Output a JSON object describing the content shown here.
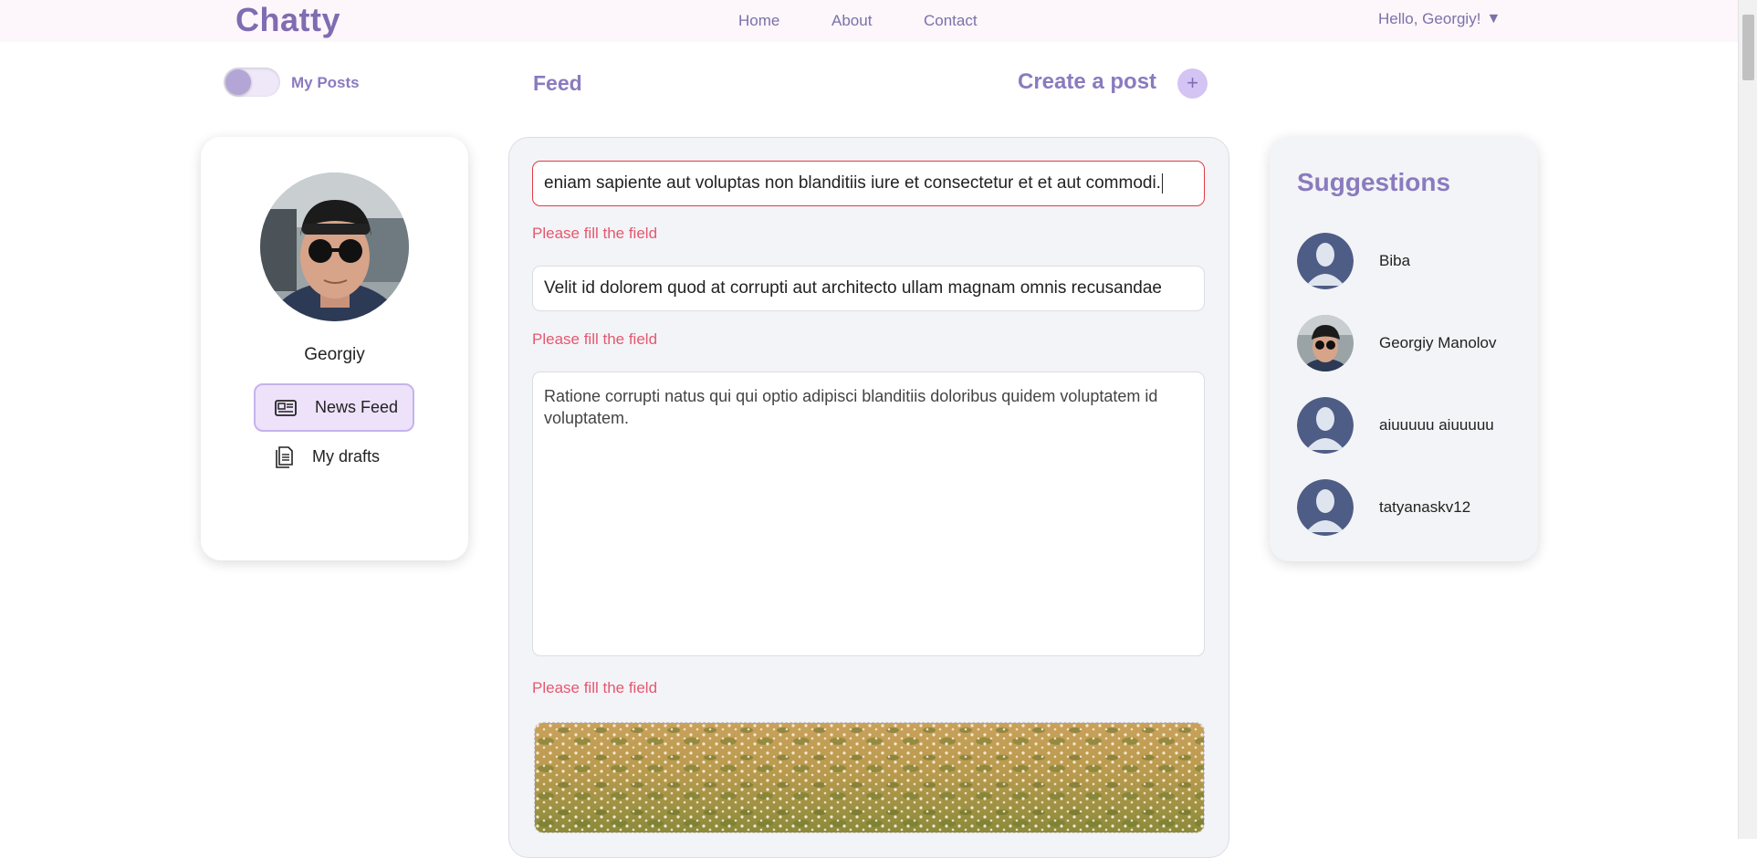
{
  "header": {
    "logo": "Chatty",
    "nav": [
      "Home",
      "About",
      "Contact"
    ],
    "greeting": "Hello, Georgiy!",
    "greeting_caret": "▼"
  },
  "toolbar": {
    "my_posts_label": "My Posts",
    "feed_title": "Feed",
    "create_post_label": "Create a post",
    "create_post_icon": "+"
  },
  "profile": {
    "name": "Georgiy",
    "menu": [
      {
        "label": "News Feed",
        "icon": "newspaper-icon",
        "active": true
      },
      {
        "label": "My drafts",
        "icon": "document-icon",
        "active": false
      }
    ]
  },
  "post_form": {
    "title_value": "eniam sapiente aut voluptas non blanditiis iure et consectetur et et aut commodi.",
    "description_value": "Velit id dolorem quod at corrupti aut architecto ullam magnam omnis recusandae",
    "body_value": "Ratione corrupti natus qui qui optio adipisci blanditiis doloribus quidem voluptatem id voluptatem.",
    "error_message": "Please fill the field"
  },
  "suggestions": {
    "title": "Suggestions",
    "users": [
      {
        "name": "Biba",
        "avatar": "default"
      },
      {
        "name": "Georgiy Manolov",
        "avatar": "photo"
      },
      {
        "name": "aiuuuuu aiuuuuu",
        "avatar": "default"
      },
      {
        "name": "tatyanaskv12",
        "avatar": "default"
      }
    ]
  },
  "colors": {
    "brand": "#7f6cb1",
    "accent_light": "#eee2fb",
    "error": "#e55870",
    "default_avatar": "#4e5d86"
  }
}
